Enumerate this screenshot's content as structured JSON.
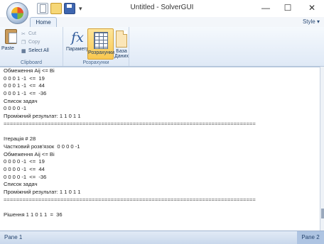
{
  "window": {
    "title": "Untitled - SolverGUI",
    "minimize": "—",
    "maximize": "☐",
    "close": "✕"
  },
  "ribbon": {
    "tab_home": "Home",
    "style_menu": "Style ▾",
    "clipboard": {
      "paste": "Paste",
      "cut": "Cut",
      "copy": "Copy",
      "select_all": "Select All",
      "group_label": "Clipboard"
    },
    "solve": {
      "params": "Параметри",
      "calc": "Розрахунки",
      "db_line1": "База",
      "db_line2": "Даних",
      "group_label": "Розрахунки"
    }
  },
  "output_lines": [
    "Обмеження Aij <= Bi",
    "0 0 0 1 -1  <=  19",
    "0 0 0 1 -1  <=  44",
    "0 0 0 1 -1  <=  -36",
    "Список задач",
    "0 0 0 0 -1",
    "Проміжний результат: 1 1 0 1 1",
    "================================================================================",
    "",
    "Ітерація # 28",
    "Частковий розв'язок  0 0 0 0 -1",
    "Обмеження Aij <= Bi",
    "0 0 0 0 -1  <=  19",
    "0 0 0 0 -1  <=  44",
    "0 0 0 0 -1  <=  -36",
    "Список задач",
    "Проміжний результат: 1 1 0 1 1",
    "================================================================================",
    "",
    "Рішення 1 1 0 1 1  =  36"
  ],
  "status": {
    "pane1": "Pane 1",
    "pane2": "Pane 2"
  }
}
